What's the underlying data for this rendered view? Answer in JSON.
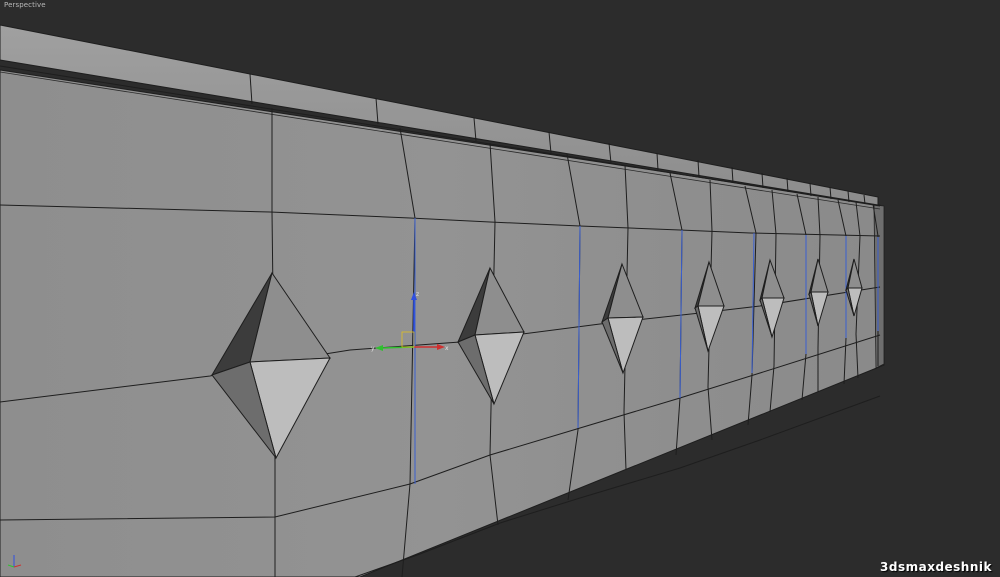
{
  "viewport": {
    "label": "Perspective",
    "background": "#2c2c2c"
  },
  "watermark": {
    "text": "3dsmaxdeshnik"
  },
  "colors": {
    "wall_face": "#8a8a8a",
    "wall_light": "#979797",
    "edge": "#1e1e1e",
    "seam": "#3a5fd0",
    "spike_light": "#bcbcbc",
    "spike_dark": "#3c3c3c",
    "gizmo_x": "#d03030",
    "gizmo_y": "#30c030",
    "gizmo_z": "#3050e0",
    "gizmo_center": "#e0c020"
  },
  "icons": {
    "gizmo": "move-gizmo-icon",
    "tripod": "axis-tripod-icon"
  }
}
